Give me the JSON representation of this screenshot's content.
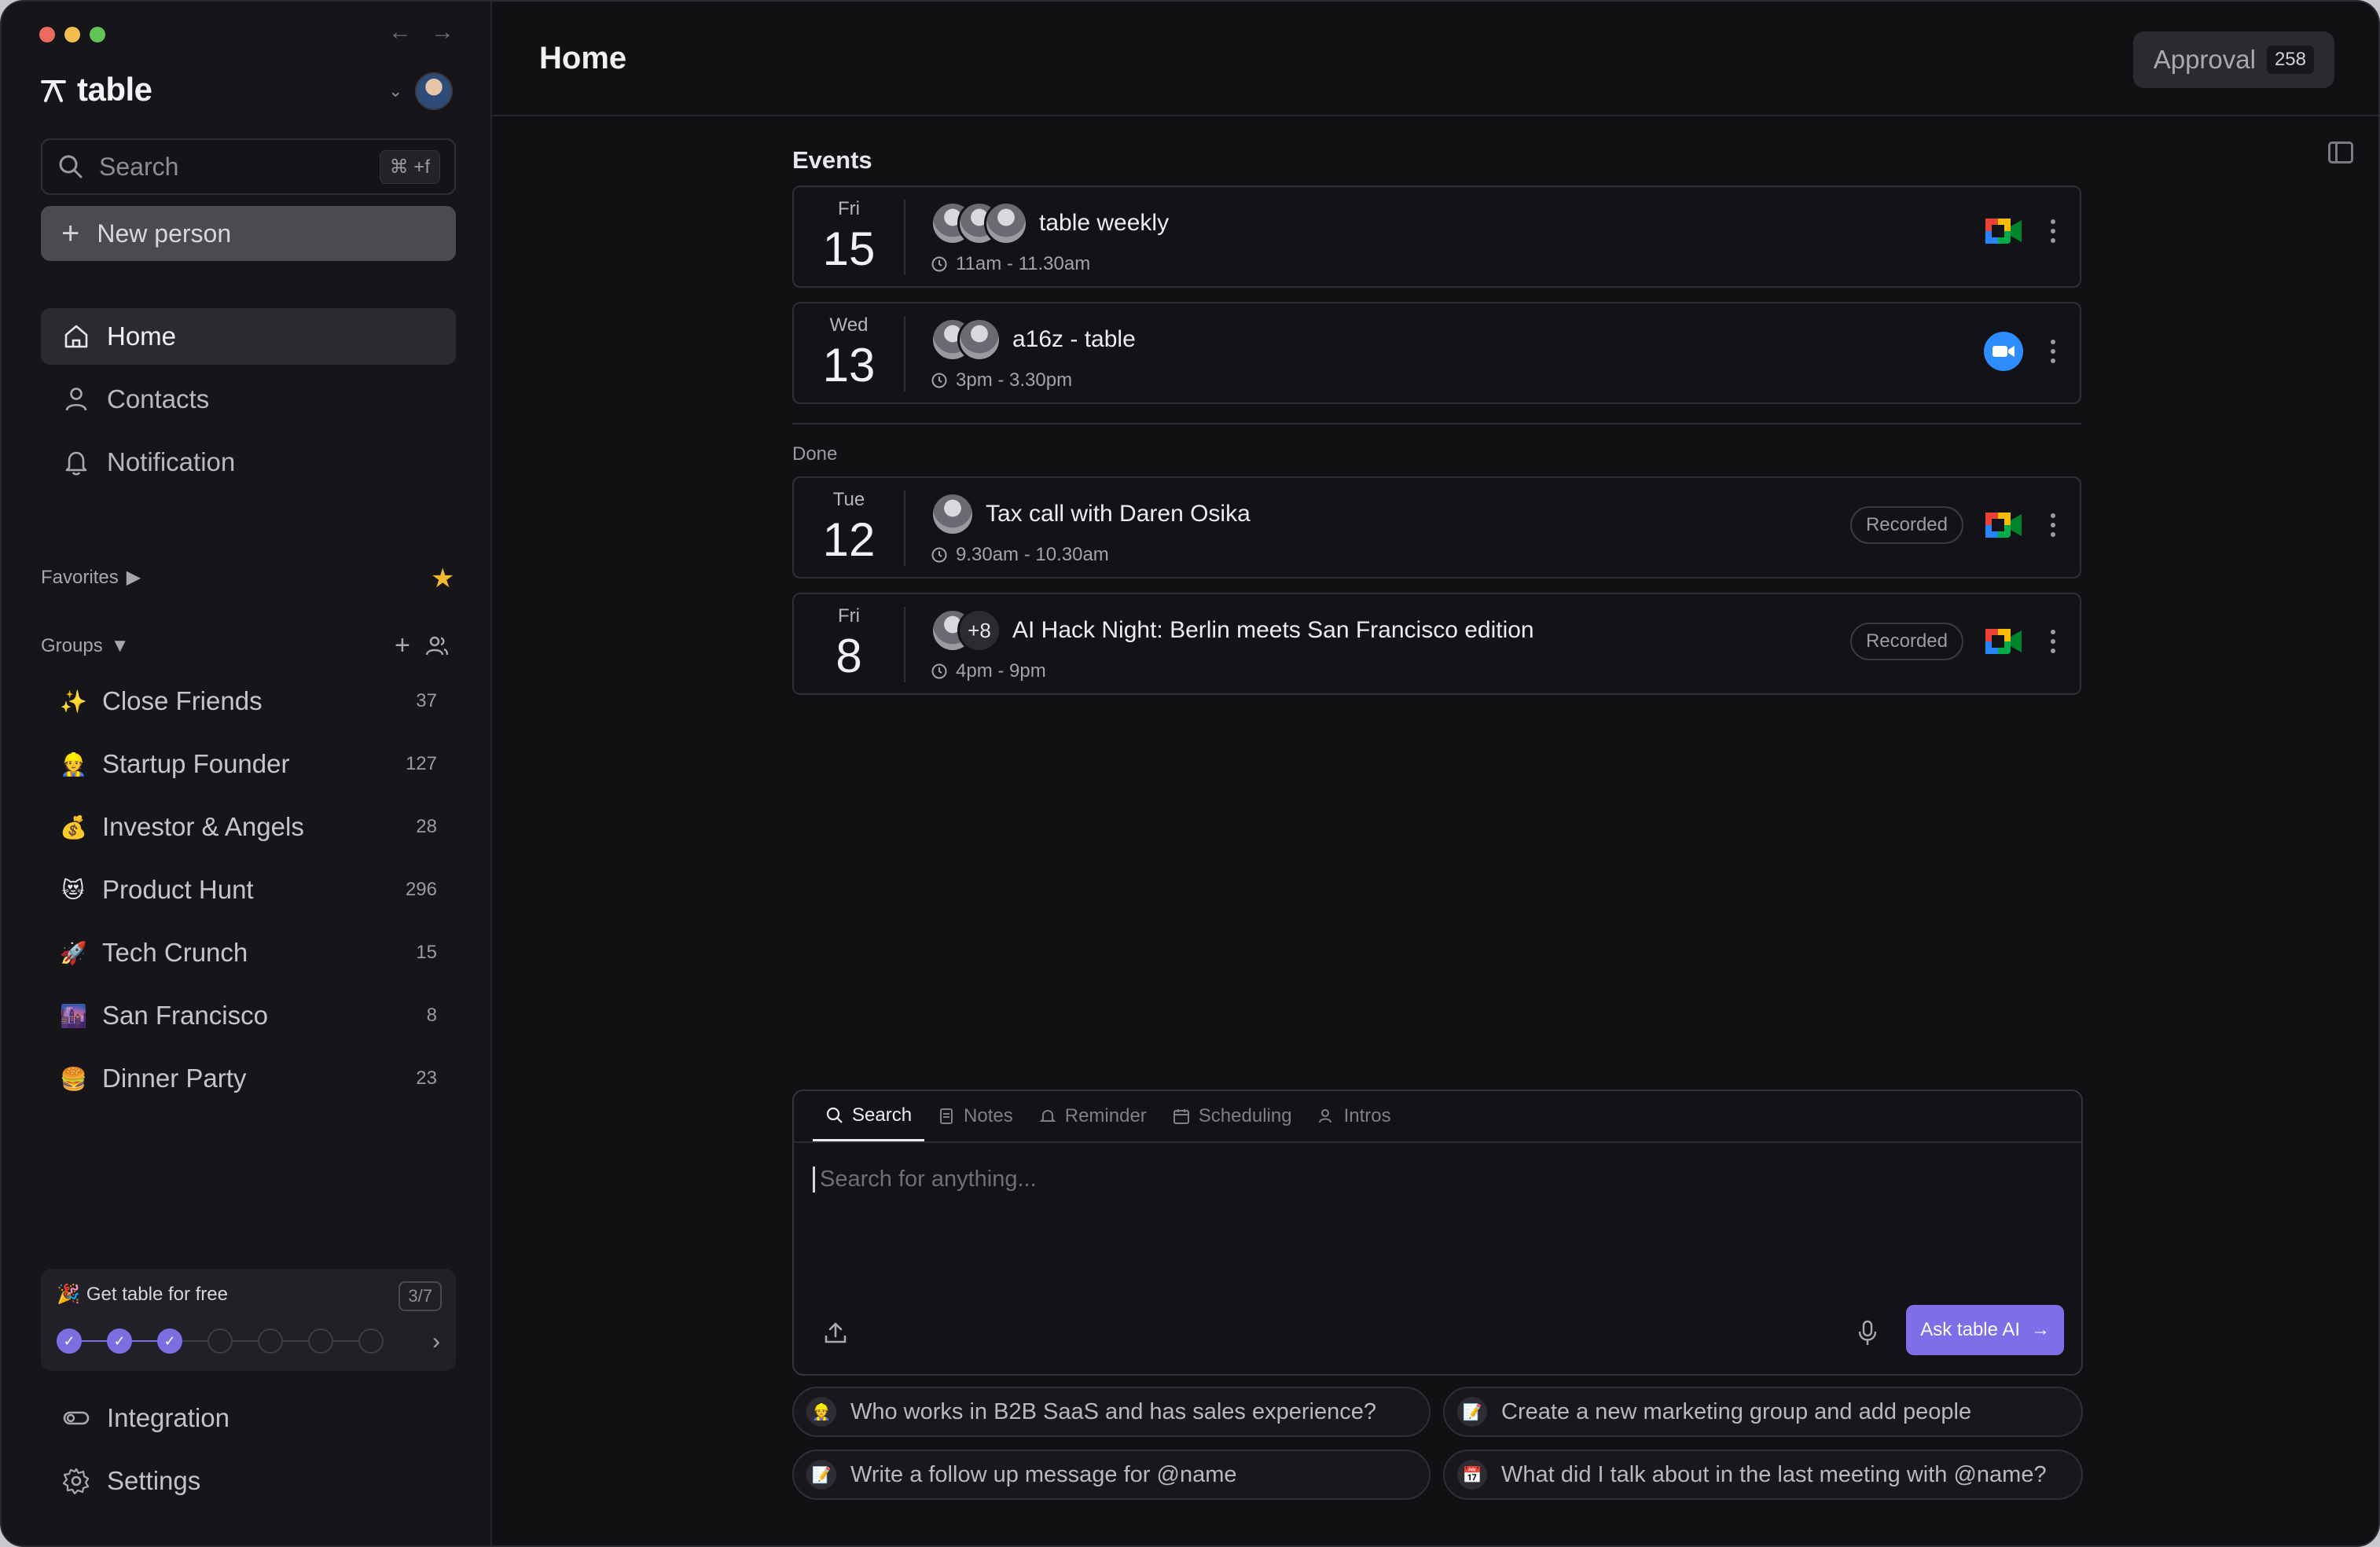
{
  "brand": {
    "name": "table"
  },
  "sidebar": {
    "search": {
      "placeholder": "Search",
      "shortcut": "⌘ +f"
    },
    "new_person": "New person",
    "nav": [
      {
        "label": "Home",
        "icon": "home-icon",
        "active": true
      },
      {
        "label": "Contacts",
        "icon": "person-icon"
      },
      {
        "label": "Notification",
        "icon": "bell-icon"
      }
    ],
    "favorites_label": "Favorites",
    "groups_label": "Groups",
    "groups": [
      {
        "emoji": "✨",
        "name": "Close Friends",
        "count": "37"
      },
      {
        "emoji": "👷",
        "name": "Startup Founder",
        "count": "127"
      },
      {
        "emoji": "💰",
        "name": "Investor & Angels",
        "count": "28"
      },
      {
        "emoji": "😻",
        "name": "Product Hunt",
        "count": "296"
      },
      {
        "emoji": "🚀",
        "name": "Tech Crunch",
        "count": "15"
      },
      {
        "emoji": "🌆",
        "name": "San Francisco",
        "count": "8"
      },
      {
        "emoji": "🍔",
        "name": "Dinner Party",
        "count": "23"
      }
    ],
    "promo": {
      "emoji": "🎉",
      "title": "Get table for free",
      "progress": "3/7",
      "steps_done": 3,
      "steps_total": 7
    },
    "bottom_nav": [
      {
        "label": "Integration",
        "icon": "integration-icon"
      },
      {
        "label": "Settings",
        "icon": "gear-icon"
      }
    ]
  },
  "header": {
    "title": "Home",
    "approval_label": "Approval",
    "approval_count": "258"
  },
  "events": {
    "label": "Events",
    "done_label": "Done",
    "upcoming": [
      {
        "dow": "Fri",
        "day": "15",
        "title": "table weekly",
        "time": "11am - 11.30am",
        "app": "google-meet",
        "attendees": 3
      },
      {
        "dow": "Wed",
        "day": "13",
        "title": "a16z - table",
        "time": "3pm - 3.30pm",
        "app": "zoom",
        "attendees": 2
      }
    ],
    "done": [
      {
        "dow": "Tue",
        "day": "12",
        "title": "Tax call with Daren Osika",
        "time": "9.30am - 10.30am",
        "status": "Recorded",
        "app": "google-meet",
        "attendees": 1
      },
      {
        "dow": "Fri",
        "day": "8",
        "title": "AI Hack Night: Berlin meets San Francisco edition",
        "time": "4pm - 9pm",
        "status": "Recorded",
        "app": "google-meet",
        "attendees": 1,
        "more": "+8"
      }
    ]
  },
  "composer": {
    "tabs": [
      "Search",
      "Notes",
      "Reminder",
      "Scheduling",
      "Intros"
    ],
    "active_tab": "Search",
    "placeholder": "Search for anything...",
    "ask_button": "Ask table AI"
  },
  "suggestions": [
    {
      "emoji": "👷",
      "text": "Who works in B2B SaaS and has sales experience?"
    },
    {
      "emoji": "📝",
      "text": "Create a new marketing group and add people"
    },
    {
      "emoji": "📝",
      "text": "Write a follow up message for @name"
    },
    {
      "emoji": "📅",
      "text": "What did I talk about in the last meeting with @name?"
    }
  ],
  "colors": {
    "accent": "#7e6ee8",
    "background": "#111114",
    "sidebar": "#16161a",
    "favorite_star": "#f5b82e"
  }
}
